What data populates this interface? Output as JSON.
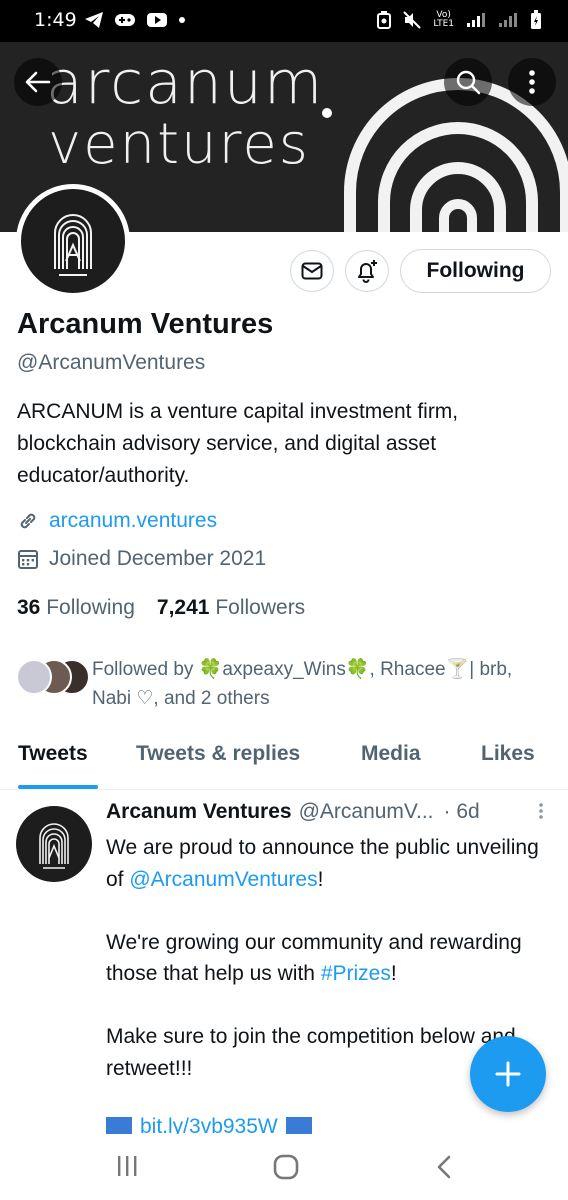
{
  "status_bar": {
    "time": "1:49",
    "lte_top": "Vo)",
    "lte_bottom": "LTE1"
  },
  "banner": {
    "line1": "arcanum",
    "line2": "ventures",
    "background": "#232323"
  },
  "actions": {
    "following_label": "Following"
  },
  "profile": {
    "name": "Arcanum Ventures",
    "handle": "@ArcanumVentures",
    "bio": "ARCANUM is a venture capital investment firm, blockchain advisory service, and digital asset educator/authority.",
    "link": "arcanum.ventures",
    "joined": "Joined December 2021",
    "following_count": "36",
    "following_label": "Following",
    "followers_count": "7,241",
    "followers_label": "Followers",
    "followed_by": "Followed by 🍀axpeaxy_Wins🍀, Rhacee🍸| brb, Nabi ♡, and 2 others"
  },
  "tabs": [
    {
      "label": "Tweets"
    },
    {
      "label": "Tweets & replies"
    },
    {
      "label": "Media"
    },
    {
      "label": "Likes"
    }
  ],
  "tweet": {
    "name": "Arcanum Ventures",
    "handle": "@ArcanumV...",
    "time": "· 6d",
    "p1_a": "We are proud to announce the public unveiling of ",
    "p1_mention": "@ArcanumVentures",
    "p1_b": "!",
    "p2_a": "We're growing our community and rewarding those that help us with ",
    "p2_hashtag": "#Prizes",
    "p2_b": "!",
    "p3": "Make sure to join the competition below and retweet!!!",
    "link_partial": "bit.ly/3vb935W"
  },
  "colors": {
    "accent": "#1d9bf0",
    "secondary_text": "#536471"
  },
  "icons": [
    "back-arrow-icon",
    "search-icon",
    "more-vertical-icon",
    "mail-icon",
    "bell-plus-icon",
    "link-icon",
    "calendar-icon",
    "compose-plus-icon",
    "recent-apps-icon",
    "home-icon",
    "nav-back-icon"
  ]
}
